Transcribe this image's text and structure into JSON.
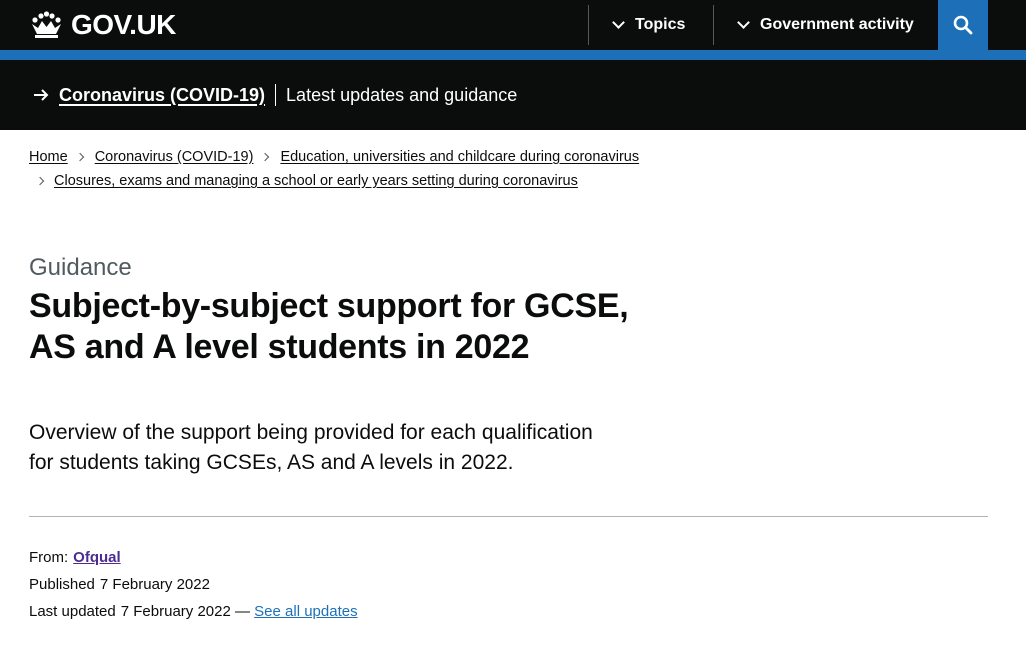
{
  "header": {
    "logo_text": "GOV.UK",
    "nav": [
      {
        "label": "Topics"
      },
      {
        "label": "Government activity"
      }
    ],
    "search_icon": "search-icon",
    "colors": {
      "header_bg": "#0b0c0c",
      "accent": "#1d70b8"
    }
  },
  "banner": {
    "link_label": "Coronavirus (COVID-19)",
    "text": "Latest updates and guidance"
  },
  "breadcrumbs": [
    {
      "label": "Home"
    },
    {
      "label": "Coronavirus (COVID-19)"
    },
    {
      "label": "Education, universities and childcare during coronavirus"
    },
    {
      "label": "Closures, exams and managing a school or early years setting during coronavirus"
    }
  ],
  "page": {
    "caption": "Guidance",
    "title_line1": "Subject-by-subject support for GCSE,",
    "title_line2": "AS and A level students in 2022",
    "lead_line1": "Overview of the support being provided for each qualification",
    "lead_line2": "for students taking GCSEs, AS and A levels in 2022."
  },
  "metadata": {
    "from_label": "From:",
    "from_org": "Ofqual",
    "published_label": "Published",
    "published_date": "7 February 2022",
    "updated_label": "Last updated",
    "updated_date": "7 February 2022",
    "updated_sep": "—",
    "see_all_label": "See all updates"
  }
}
